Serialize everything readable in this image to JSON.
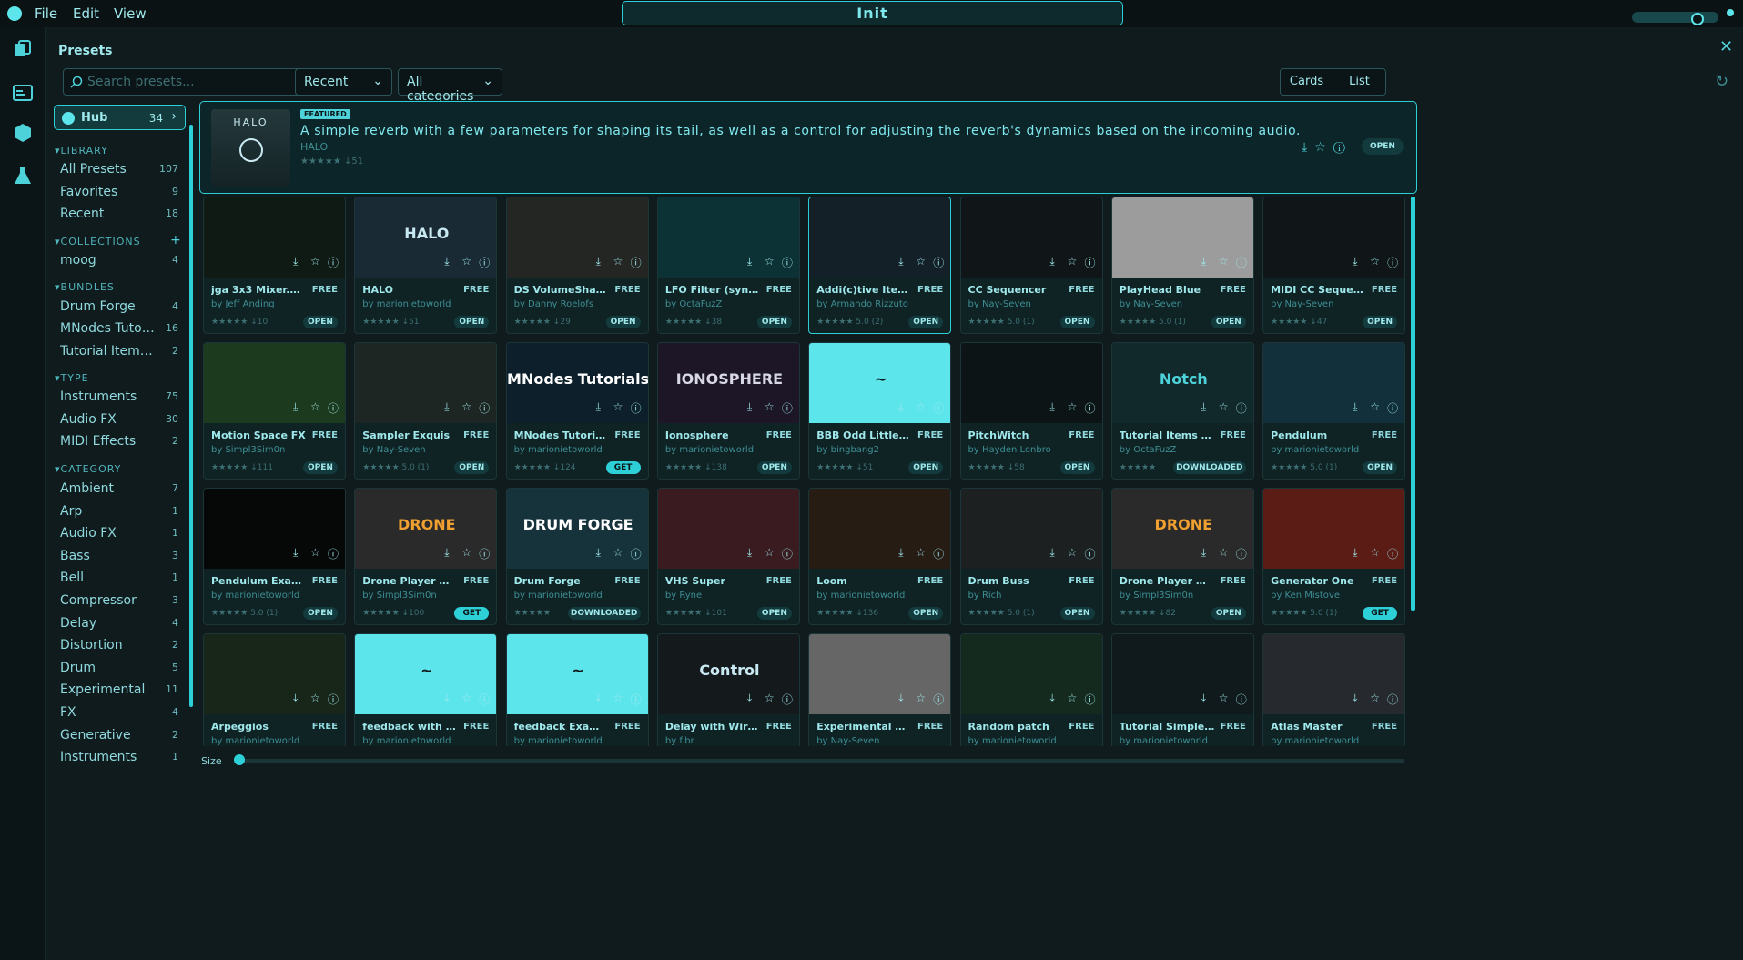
{
  "menu": {
    "file": "File",
    "edit": "Edit",
    "view": "View"
  },
  "preset_title": "Init",
  "panel_title": "Presets",
  "search": {
    "placeholder": "Search presets..."
  },
  "sort": "Recent",
  "category_filter": "All categories",
  "view_modes": {
    "cards": "Cards",
    "list": "List"
  },
  "hub": {
    "label": "Hub",
    "count": "34"
  },
  "library": {
    "heading": "LIBRARY",
    "items": [
      {
        "label": "All Presets",
        "count": "107"
      },
      {
        "label": "Favorites",
        "count": "9"
      },
      {
        "label": "Recent",
        "count": "18"
      }
    ]
  },
  "collections": {
    "heading": "COLLECTIONS",
    "items": [
      {
        "label": "moog",
        "count": "4"
      }
    ]
  },
  "bundles": {
    "heading": "BUNDLES",
    "items": [
      {
        "label": "Drum Forge",
        "count": "4"
      },
      {
        "label": "MNodes Tutorials",
        "count": "16"
      },
      {
        "label": "Tutorial Items as Bundle",
        "count": "2"
      }
    ]
  },
  "types": {
    "heading": "TYPE",
    "items": [
      {
        "label": "Instruments",
        "count": "75"
      },
      {
        "label": "Audio FX",
        "count": "30"
      },
      {
        "label": "MIDI Effects",
        "count": "2"
      }
    ]
  },
  "categories": {
    "heading": "CATEGORY",
    "items": [
      {
        "label": "Ambient",
        "count": "7"
      },
      {
        "label": "Arp",
        "count": "1"
      },
      {
        "label": "Audio FX",
        "count": "1"
      },
      {
        "label": "Bass",
        "count": "3"
      },
      {
        "label": "Bell",
        "count": "1"
      },
      {
        "label": "Compressor",
        "count": "3"
      },
      {
        "label": "Delay",
        "count": "4"
      },
      {
        "label": "Distortion",
        "count": "2"
      },
      {
        "label": "Drum",
        "count": "5"
      },
      {
        "label": "Experimental",
        "count": "11"
      },
      {
        "label": "FX",
        "count": "4"
      },
      {
        "label": "Generative",
        "count": "2"
      },
      {
        "label": "Instruments",
        "count": "1"
      }
    ]
  },
  "featured": {
    "tag": "FEATURED",
    "description": "A simple reverb with a few parameters for shaping its tail, as well as a control for adjusting the reverb's dynamics based on the incoming audio.",
    "author": "HALO",
    "stats": "★★★★★  ↓51",
    "thumb_text": "HALO",
    "open": "OPEN"
  },
  "size_label": "Size",
  "size_value": 0.0,
  "cards": [
    {
      "title": "jga 3x3 Mixer.Sp...",
      "price": "FREE",
      "author": "by Jeff Anding",
      "stats": "★★★★★  ↓10",
      "button": "OPEN",
      "thumb_bg": "#101a14",
      "thumb_text": "",
      "thumb_color": "#9fe8ec"
    },
    {
      "title": "HALO",
      "price": "FREE",
      "author": "by marionietoworld",
      "stats": "★★★★★  ↓51",
      "button": "OPEN",
      "thumb_bg": "#1a2a35",
      "thumb_text": "HALO",
      "thumb_color": "#c9e9f2"
    },
    {
      "title": "DS VolumeShaper",
      "price": "FREE",
      "author": "by Danny Roelofs",
      "stats": "★★★★★  ↓29",
      "button": "OPEN",
      "thumb_bg": "#242624",
      "thumb_text": "",
      "thumb_color": "#9fe8ec"
    },
    {
      "title": "LFO Filter (sync...",
      "price": "FREE",
      "author": "by OctaFuzZ",
      "stats": "★★★★★  ↓38",
      "button": "OPEN",
      "thumb_bg": "#0c3236",
      "thumb_text": "",
      "thumb_color": "#9fe8ec"
    },
    {
      "title": "Addi(c)tive Itera...",
      "price": "FREE",
      "author": "by Armando Rizzuto",
      "stats": "★★★★★  5.0 (2)",
      "button": "OPEN",
      "thumb_bg": "#142028",
      "thumb_text": "",
      "thumb_color": "#9fe8ec"
    },
    {
      "title": "CC Sequencer",
      "price": "FREE",
      "author": "by Nay-Seven",
      "stats": "★★★★★  5.0 (1)",
      "button": "OPEN",
      "thumb_bg": "#101617",
      "thumb_text": "",
      "thumb_color": "#9fe8ec"
    },
    {
      "title": "PlayHead Blue",
      "price": "FREE",
      "author": "by Nay-Seven",
      "stats": "★★★★★  5.0 (1)",
      "button": "OPEN",
      "thumb_bg": "#9c9c9c",
      "thumb_text": "",
      "thumb_color": "#ffffff"
    },
    {
      "title": "MIDI CC Sequen...",
      "price": "FREE",
      "author": "by Nay-Seven",
      "stats": "★★★★★  ↓47",
      "button": "OPEN",
      "thumb_bg": "#101617",
      "thumb_text": "",
      "thumb_color": "#9fe8ec"
    },
    {
      "title": "Motion Space FX",
      "price": "FREE",
      "author": "by Simpl3Sim0n",
      "stats": "★★★★★  ↓111",
      "button": "OPEN",
      "thumb_bg": "#1c3a1e",
      "thumb_text": "",
      "thumb_color": "#9fe8ec"
    },
    {
      "title": "Sampler Exquis",
      "price": "FREE",
      "author": "by Nay-Seven",
      "stats": "★★★★★  5.0 (1)",
      "button": "OPEN",
      "thumb_bg": "#1e2624",
      "thumb_text": "",
      "thumb_color": "#9fe8ec"
    },
    {
      "title": "MNodes Tutorial...",
      "price": "FREE",
      "author": "by marionietoworld",
      "stats": "★★★★★  ↓124",
      "button": "GET",
      "thumb_bg": "#0d1f2a",
      "thumb_text": "MNodes Tutorials",
      "thumb_color": "#ffffff"
    },
    {
      "title": "Ionosphere",
      "price": "FREE",
      "author": "by marionietoworld",
      "stats": "★★★★★  ↓138",
      "button": "OPEN",
      "thumb_bg": "#1c1626",
      "thumb_text": "IONOSPHERE",
      "thumb_color": "#d9d9e6"
    },
    {
      "title": "BBB Odd Little ...",
      "price": "FREE",
      "author": "by bingbang2",
      "stats": "★★★★★  ↓51",
      "button": "OPEN",
      "thumb_bg": "#5ce6ec",
      "thumb_text": "~",
      "thumb_color": "#0b1416"
    },
    {
      "title": "PitchWitch",
      "price": "FREE",
      "author": "by Hayden Lonbro",
      "stats": "★★★★★  ↓58",
      "button": "OPEN",
      "thumb_bg": "#0c1416",
      "thumb_text": "",
      "thumb_color": "#9fe8ec"
    },
    {
      "title": "Tutorial Items as...",
      "price": "FREE",
      "author": "by OctaFuzZ",
      "stats": "★★★★★",
      "button": "DOWNLOADED",
      "thumb_bg": "#12292c",
      "thumb_text": "Notch",
      "thumb_color": "#4ed2da"
    },
    {
      "title": "Pendulum",
      "price": "FREE",
      "author": "by marionietoworld",
      "stats": "★★★★★  5.0 (1)",
      "button": "OPEN",
      "thumb_bg": "#12303c",
      "thumb_text": "",
      "thumb_color": "#9fe8ec"
    },
    {
      "title": "Pendulum Exam...",
      "price": "FREE",
      "author": "by marionietoworld",
      "stats": "★★★★★  5.0 (1)",
      "button": "OPEN",
      "thumb_bg": "#050807",
      "thumb_text": "",
      "thumb_color": "#9fe8ec"
    },
    {
      "title": "Drone Player wit...",
      "price": "FREE",
      "author": "by Simpl3Sim0n",
      "stats": "★★★★★  ↓100",
      "button": "GET",
      "thumb_bg": "#2a2a2a",
      "thumb_text": "DRONE",
      "thumb_color": "#f0a030"
    },
    {
      "title": "Drum Forge",
      "price": "FREE",
      "author": "by marionietoworld",
      "stats": "★★★★★",
      "button": "DOWNLOADED",
      "thumb_bg": "#16323a",
      "thumb_text": "DRUM FORGE",
      "thumb_color": "#ffffff"
    },
    {
      "title": "VHS Super",
      "price": "FREE",
      "author": "by Ryne",
      "stats": "★★★★★  ↓101",
      "button": "OPEN",
      "thumb_bg": "#3a1c20",
      "thumb_text": "",
      "thumb_color": "#9fe8ec"
    },
    {
      "title": "Loom",
      "price": "FREE",
      "author": "by marionietoworld",
      "stats": "★★★★★  ↓136",
      "button": "OPEN",
      "thumb_bg": "#261c14",
      "thumb_text": "",
      "thumb_color": "#f0a030"
    },
    {
      "title": "Drum Buss",
      "price": "FREE",
      "author": "by Rich",
      "stats": "★★★★★  5.0 (1)",
      "button": "OPEN",
      "thumb_bg": "#1c2020",
      "thumb_text": "",
      "thumb_color": "#9fe8ec"
    },
    {
      "title": "Drone Player Wi...",
      "price": "FREE",
      "author": "by Simpl3Sim0n",
      "stats": "★★★★★  ↓82",
      "button": "OPEN",
      "thumb_bg": "#2a2a2a",
      "thumb_text": "DRONE",
      "thumb_color": "#f0a030"
    },
    {
      "title": "Generator One",
      "price": "FREE",
      "author": "by Ken Mistove",
      "stats": "★★★★★  5.0 (1)",
      "button": "GET",
      "thumb_bg": "#5a1c14",
      "thumb_text": "",
      "thumb_color": "#f0a030"
    },
    {
      "title": "Arpeggios",
      "price": "FREE",
      "author": "by marionietoworld",
      "stats": "",
      "button": "",
      "thumb_bg": "#18261a",
      "thumb_text": "",
      "thumb_color": "#9fe8ec"
    },
    {
      "title": "feedback with P...",
      "price": "FREE",
      "author": "by marionietoworld",
      "stats": "",
      "button": "",
      "thumb_bg": "#5ce6ec",
      "thumb_text": "~",
      "thumb_color": "#0b1416"
    },
    {
      "title": "feedback Examp...",
      "price": "FREE",
      "author": "by marionietoworld",
      "stats": "",
      "button": "",
      "thumb_bg": "#5ce6ec",
      "thumb_text": "~",
      "thumb_color": "#0b1416"
    },
    {
      "title": "Delay with Wire ...",
      "price": "FREE",
      "author": "by f.br",
      "stats": "",
      "button": "",
      "thumb_bg": "#141a1c",
      "thumb_text": "Control",
      "thumb_color": "#c9e9f2"
    },
    {
      "title": "Experimental mi...",
      "price": "FREE",
      "author": "by Nay-Seven",
      "stats": "",
      "button": "",
      "thumb_bg": "#666666",
      "thumb_text": "",
      "thumb_color": "#ffffff"
    },
    {
      "title": "Random patch",
      "price": "FREE",
      "author": "by marionietoworld",
      "stats": "",
      "button": "",
      "thumb_bg": "#142a1e",
      "thumb_text": "",
      "thumb_color": "#9fe8ec"
    },
    {
      "title": "Tutorial Simple ...",
      "price": "FREE",
      "author": "by marionietoworld",
      "stats": "",
      "button": "",
      "thumb_bg": "#101a1c",
      "thumb_text": "",
      "thumb_color": "#9fe8ec"
    },
    {
      "title": "Atlas Master",
      "price": "FREE",
      "author": "by marionietoworld",
      "stats": "",
      "button": "",
      "thumb_bg": "#262a2e",
      "thumb_text": "",
      "thumb_color": "#9fe8ec"
    }
  ]
}
